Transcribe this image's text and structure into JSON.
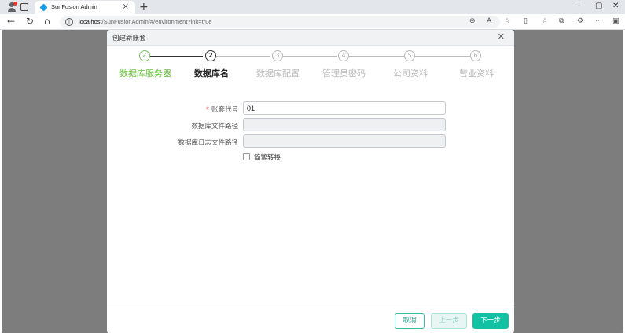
{
  "browser": {
    "tab_title": "SunFusion Admin",
    "tab_close": "×",
    "new_tab": "+",
    "url_host": "localhost",
    "url_path": "/SunFusionAdmin/#/environment?init=true",
    "win_min": "–",
    "win_restore": "▢",
    "win_close": "✕"
  },
  "dialog": {
    "title": "创建新账套",
    "close": "✕"
  },
  "steps": [
    {
      "number": "✓",
      "label": "数据库服务器",
      "state": "done"
    },
    {
      "number": "2",
      "label": "数据库名",
      "state": "active"
    },
    {
      "number": "3",
      "label": "数据库配置",
      "state": "pending"
    },
    {
      "number": "4",
      "label": "管理员密码",
      "state": "pending"
    },
    {
      "number": "5",
      "label": "公司资料",
      "state": "pending"
    },
    {
      "number": "6",
      "label": "营业资料",
      "state": "pending"
    }
  ],
  "form": {
    "account_code_label": "账套代号",
    "account_code_value": "01",
    "required_mark": "*",
    "db_file_path_label": "数据库文件路径",
    "db_file_path_value": "",
    "db_log_path_label": "数据库日志文件路径",
    "db_log_path_value": "",
    "convert_checkbox_label": "简繁转换",
    "convert_checked": false
  },
  "footer": {
    "cancel": "取消",
    "prev": "上一步",
    "next": "下一步"
  },
  "colors": {
    "accent": "#13c2a2",
    "done_step": "#67c23a",
    "overlay": "#7d7d7d"
  }
}
